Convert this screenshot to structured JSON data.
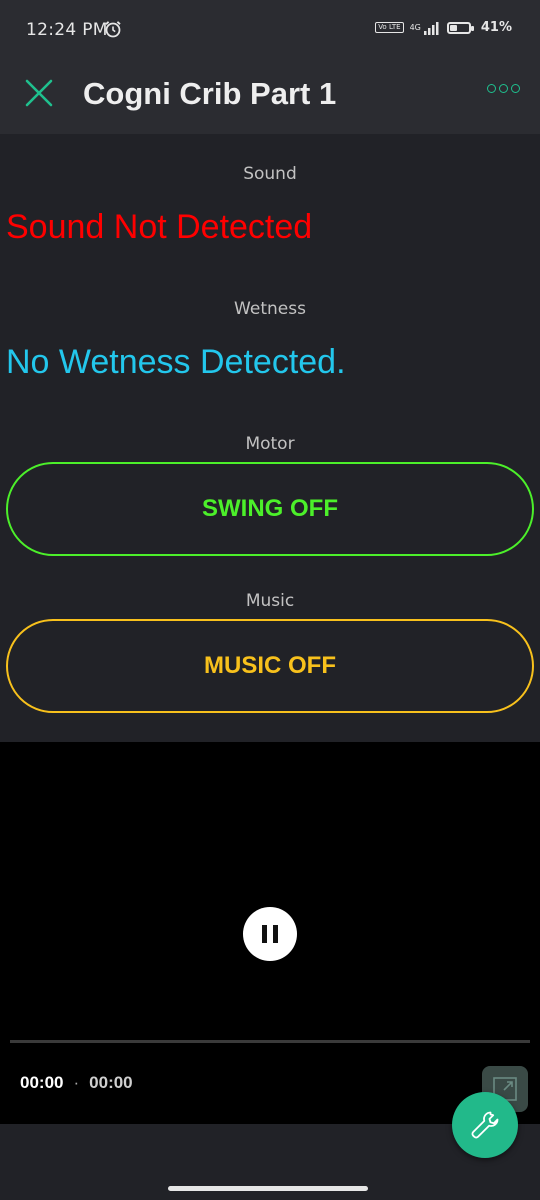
{
  "status_bar": {
    "time": "12:24 PM",
    "network_tag": "Vo LTE",
    "network_gen": "4G",
    "battery_text": "41%",
    "battery_level": 0.41
  },
  "header": {
    "title": "Cogni Crib Part 1"
  },
  "widgets": {
    "sound": {
      "label": "Sound",
      "value": "Sound Not Detected",
      "color": "#ff0000"
    },
    "wetness": {
      "label": "Wetness",
      "value": "No Wetness Detected.",
      "color": "#23c7ec"
    },
    "motor": {
      "label": "Motor",
      "button_label": "SWING OFF",
      "color": "#4cf02a"
    },
    "music": {
      "label": "Music",
      "button_label": "MUSIC OFF",
      "color": "#f8c11c"
    }
  },
  "video": {
    "current_time": "00:00",
    "separator": "·",
    "duration": "00:00",
    "progress": 0.0
  },
  "colors": {
    "accent": "#1fc08e",
    "fab": "#22b98a",
    "background": "#212227",
    "header": "#2b2c31"
  }
}
